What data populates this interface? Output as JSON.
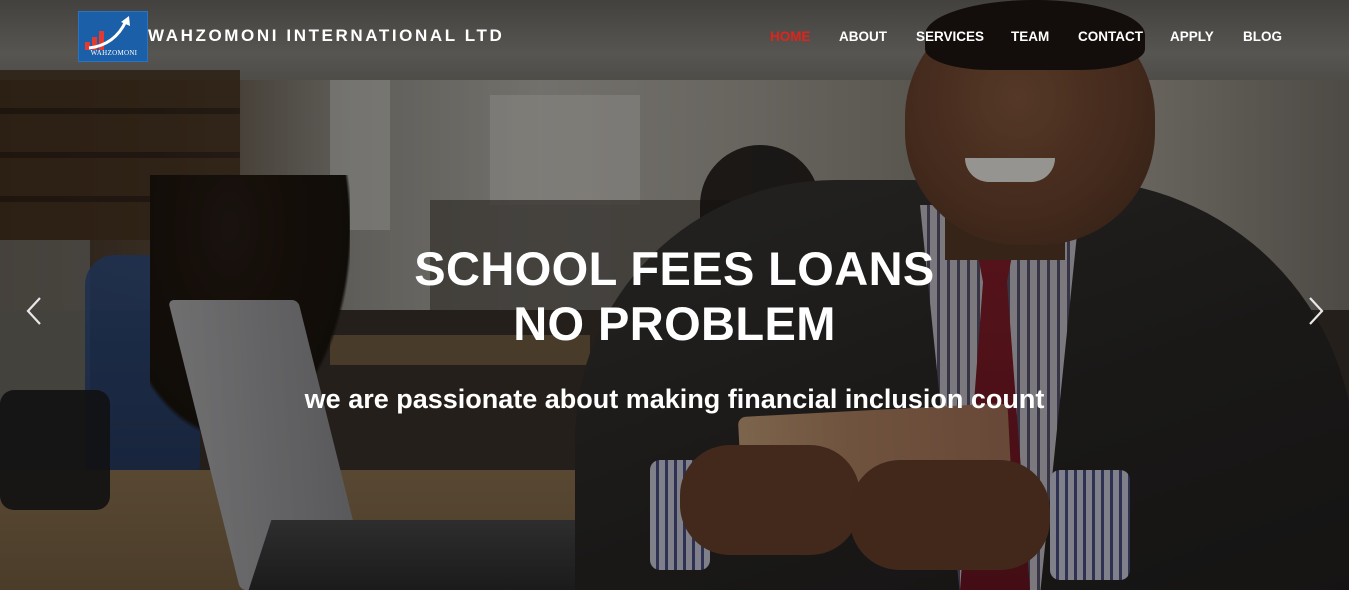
{
  "brand": {
    "name": "WAHZOMONI INTERNATIONAL LTD",
    "logo_text": "WAHZOMONI",
    "logo_color": "#1a5fa8"
  },
  "nav": {
    "items": [
      {
        "label": "HOME",
        "active": true
      },
      {
        "label": "ABOUT",
        "active": false
      },
      {
        "label": "SERVICES",
        "active": false
      },
      {
        "label": "TEAM",
        "active": false
      },
      {
        "label": "CONTACT",
        "active": false
      },
      {
        "label": "APPLY",
        "active": false
      },
      {
        "label": "BLOG",
        "active": false
      }
    ],
    "active_color": "#e0241b"
  },
  "hero": {
    "headline_line1": "SCHOOL FEES LOANS",
    "headline_line2": "NO PROBLEM",
    "tagline": "we are passionate about making financial inclusion count",
    "prev_icon": "chevron-left-icon",
    "next_icon": "chevron-right-icon"
  }
}
